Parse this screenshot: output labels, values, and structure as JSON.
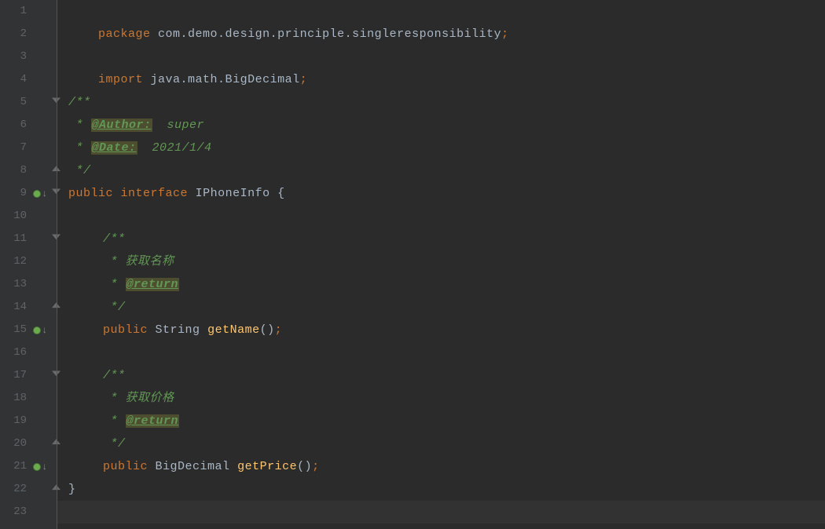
{
  "line_numbers": [
    "1",
    "2",
    "3",
    "4",
    "5",
    "6",
    "7",
    "8",
    "9",
    "10",
    "11",
    "12",
    "13",
    "14",
    "15",
    "16",
    "17",
    "18",
    "19",
    "20",
    "21",
    "22",
    "23"
  ],
  "code": {
    "l1": {
      "package_kw": "package",
      "package_name": "com.demo.design.principle.singleresponsibility",
      "semi": ";"
    },
    "l3": {
      "import_kw": "import",
      "import_name": "java.math.BigDecimal",
      "semi": ";"
    },
    "l5": {
      "doc_open": "/**"
    },
    "l6": {
      "star": " * ",
      "author_tag": "@Author:",
      "author_val": "  super"
    },
    "l7": {
      "star": " * ",
      "date_tag": "@Date:",
      "date_val": "  2021/1/4"
    },
    "l8": {
      "doc_close": " */"
    },
    "l9": {
      "public_kw": "public",
      "interface_kw": "interface",
      "name": "IPhoneInfo",
      "brace": "{"
    },
    "l11": {
      "doc_open": "/**"
    },
    "l12": {
      "text": " * 获取名称"
    },
    "l13": {
      "star": " * ",
      "return_tag": "@return"
    },
    "l14": {
      "doc_close": " */"
    },
    "l15": {
      "public_kw": "public",
      "ret": "String",
      "method": "getName",
      "parens": "()",
      "semi": ";"
    },
    "l17": {
      "doc_open": "/**"
    },
    "l18": {
      "text": " * 获取价格"
    },
    "l19": {
      "star": " * ",
      "return_tag": "@return"
    },
    "l20": {
      "doc_close": " */"
    },
    "l21": {
      "public_kw": "public",
      "ret": "BigDecimal",
      "method": "getPrice",
      "parens": "()",
      "semi": ";"
    },
    "l22": {
      "brace": "}"
    }
  },
  "line_height": 29
}
